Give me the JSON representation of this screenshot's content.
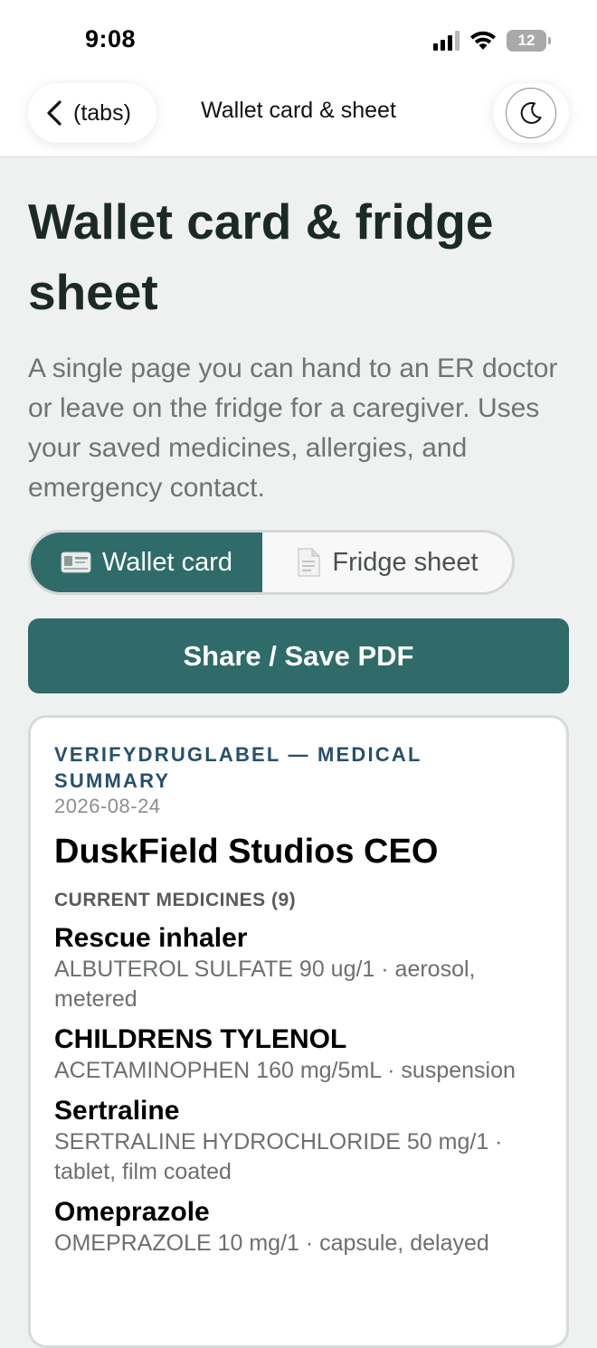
{
  "status_bar": {
    "time": "9:08",
    "battery": "12"
  },
  "nav": {
    "back_label": "(tabs)",
    "title": "Wallet card & sheet"
  },
  "page": {
    "title": "Wallet card & fridge sheet",
    "description": "A single page you can hand to an ER doctor or leave on the fridge for a caregiver. Uses your saved medicines, allergies, and emergency contact."
  },
  "tabs": [
    {
      "label": "Wallet card",
      "icon": "id-card-icon",
      "selected": true
    },
    {
      "label": "Fridge sheet",
      "icon": "document-icon",
      "selected": false
    }
  ],
  "share_button": {
    "label": "Share / Save PDF"
  },
  "card": {
    "brand": "VERIFYDRUGLABEL — MEDICAL SUMMARY",
    "date": "2026-08-24",
    "name": "DuskField Studios CEO",
    "medicines_heading": "CURRENT MEDICINES (9)",
    "medicines": [
      {
        "name": "Rescue inhaler",
        "detail": "ALBUTEROL SULFATE 90 ug/1 · aerosol, metered"
      },
      {
        "name": "CHILDRENS TYLENOL",
        "detail": "ACETAMINOPHEN 160 mg/5mL · suspension"
      },
      {
        "name": "Sertraline",
        "detail": "SERTRALINE HYDROCHLORIDE 50 mg/1 · tablet, film coated"
      },
      {
        "name": "Omeprazole",
        "detail": "OMEPRAZOLE 10 mg/1 · capsule, delayed"
      }
    ]
  },
  "colors": {
    "accent": "#2e6b69",
    "brand_text": "#27506b",
    "background": "#eff1f0"
  }
}
